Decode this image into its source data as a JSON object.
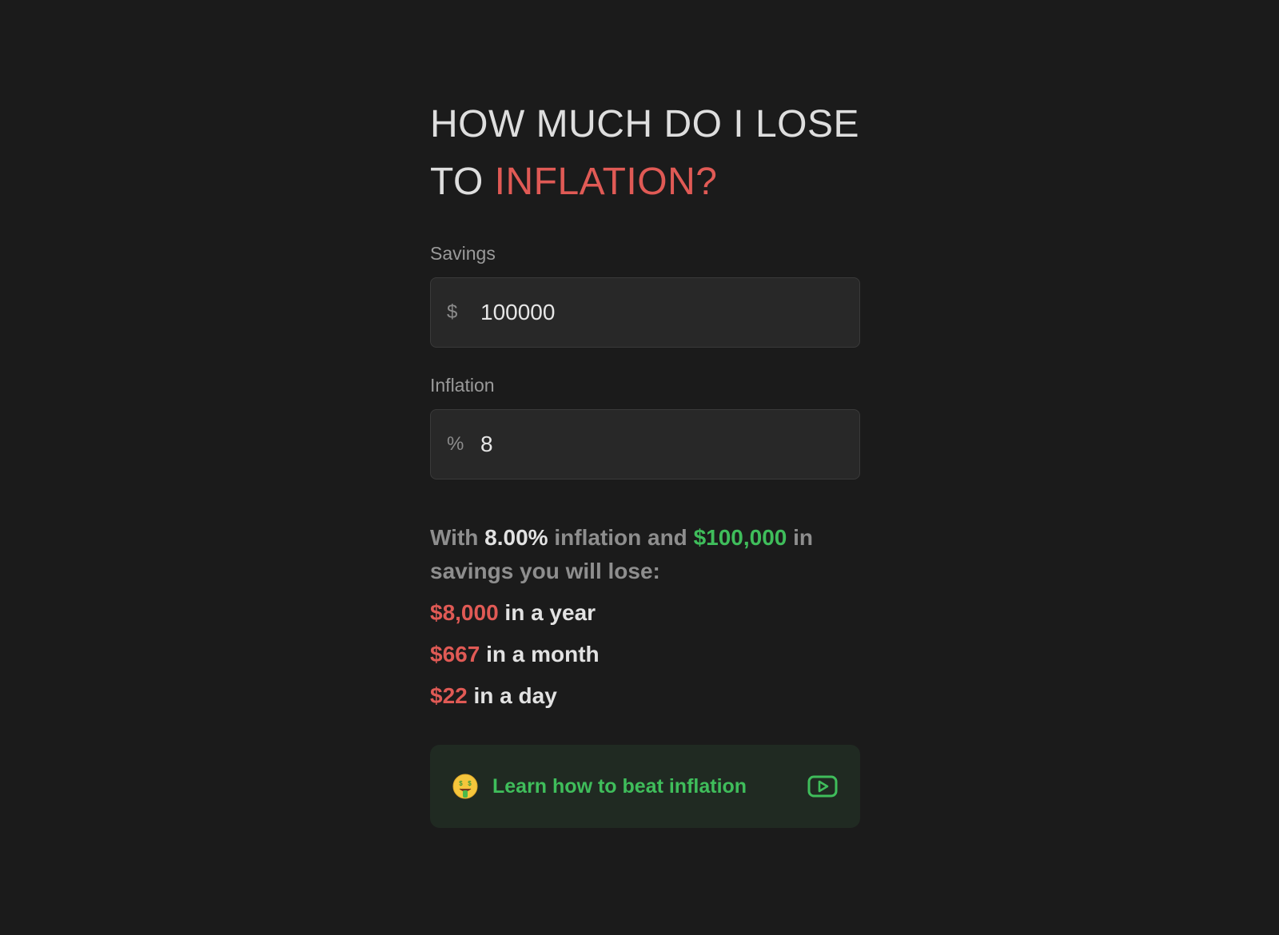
{
  "heading": {
    "line1": "HOW MUCH DO I LOSE",
    "line2_prefix": "TO ",
    "line2_accent": "INFLATION?"
  },
  "savings": {
    "label": "Savings",
    "prefix": "$",
    "value": "100000"
  },
  "inflation": {
    "label": "Inflation",
    "prefix": "%",
    "value": "8"
  },
  "summary": {
    "with": "With ",
    "rate": "8.00%",
    "mid": " inflation and ",
    "amount": "$100,000",
    "tail": " in savings you will lose:"
  },
  "losses": [
    {
      "amount": "$8,000",
      "period": " in a year"
    },
    {
      "amount": "$667",
      "period": " in a month"
    },
    {
      "amount": "$22",
      "period": " in a day"
    }
  ],
  "cta": {
    "label": "Learn how to beat inflation",
    "emoji_icon": "money-mouth-face-icon",
    "video_icon": "youtube-play-icon"
  },
  "colors": {
    "background": "#1b1b1b",
    "red_accent": "#e05a55",
    "green_accent": "#3fbd5b"
  }
}
